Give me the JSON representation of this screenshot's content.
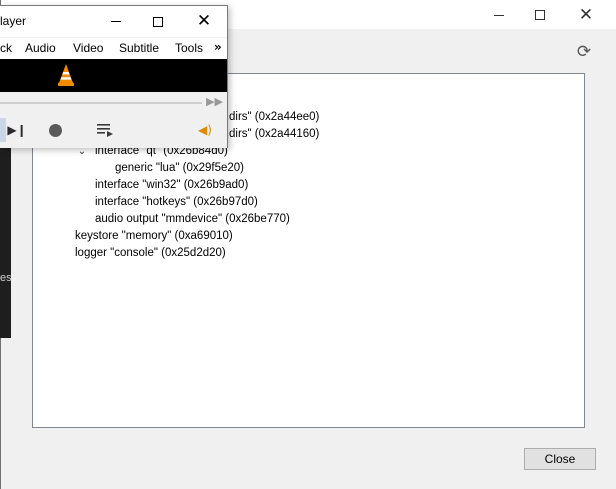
{
  "dialog": {
    "controls": {
      "minimize": "minimize",
      "maximize": "maximize",
      "close": "close"
    },
    "refresh_icon": "refresh-icon",
    "tree": [
      {
        "label": "dirs\" (0x2a44ee0)",
        "indent": 0,
        "toggle": ""
      },
      {
        "label": "dirs\" (0x2a44160)",
        "indent": 0,
        "toggle": ""
      },
      {
        "label": "interface \"qt\" (0x26b84d0)",
        "indent": 1,
        "toggle": "expanded"
      },
      {
        "label": "generic \"lua\" (0x29f5e20)",
        "indent": 2,
        "toggle": ""
      },
      {
        "label": "interface \"win32\" (0x26b9ad0)",
        "indent": 1,
        "toggle": ""
      },
      {
        "label": "interface \"hotkeys\" (0x26b97d0)",
        "indent": 1,
        "toggle": ""
      },
      {
        "label": "audio output \"mmdevice\" (0x26be770)",
        "indent": 1,
        "toggle": ""
      },
      {
        "label": "keystore \"memory\" (0xa69010)",
        "indent": 0,
        "toggle": ""
      },
      {
        "label": "logger \"console\" (0x25d2d20)",
        "indent": 0,
        "toggle": ""
      }
    ],
    "close_button": "Close"
  },
  "vlc": {
    "title": "layer",
    "menu": [
      "ck",
      "Audio",
      "Video",
      "Subtitle",
      "Tools"
    ],
    "menu_more": "»",
    "icons": {
      "cone": "vlc-cone-icon",
      "seek_forward": "seek-forward-icon",
      "skip_next": "skip-next-icon",
      "record": "record-icon",
      "playlist": "playlist-icon",
      "volume": "volume-icon"
    }
  },
  "desktop_strip_char": "es"
}
